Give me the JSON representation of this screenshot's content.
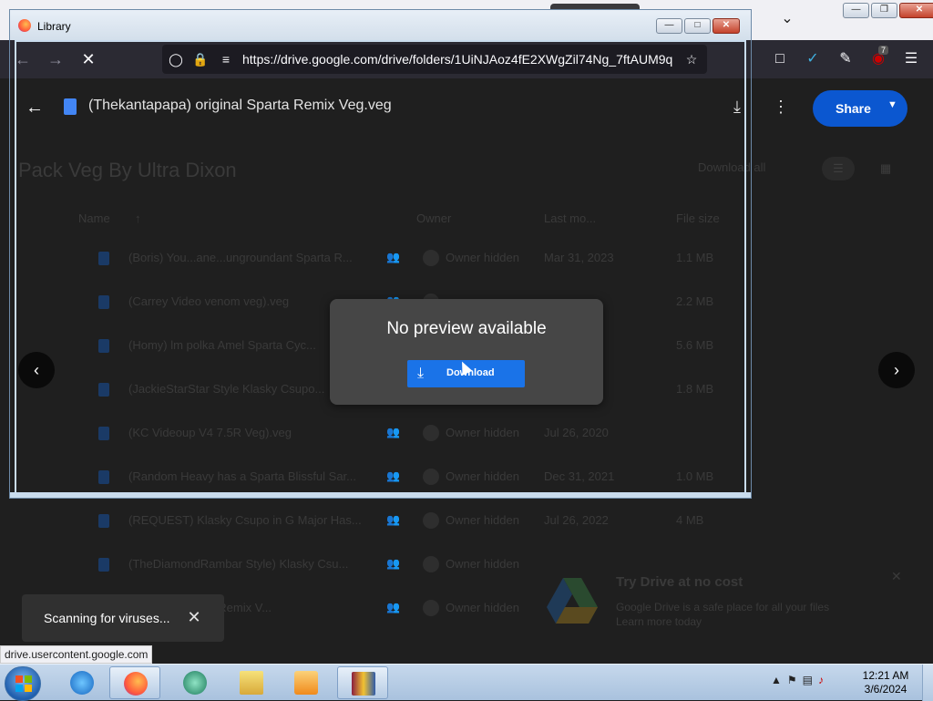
{
  "browser": {
    "url": "https://drive.google.com/drive/folders/1UiNJAoz4fE2XWgZil74Ng_7ftAUM9q",
    "status_text": "drive.usercontent.google.com",
    "extension_badge": "7"
  },
  "library_window": {
    "title": "Library"
  },
  "viewer": {
    "file_title": "(Thekantapapa) original Sparta Remix Veg.veg",
    "share_label": "Share",
    "no_preview_text": "No preview available",
    "download_label": "Download"
  },
  "folder": {
    "title": "Pack Veg By Ultra Dixon",
    "download_all": "Download all",
    "columns": [
      "Name",
      "Owner",
      "Last mo...",
      "File size"
    ],
    "rows": [
      {
        "name": "(Boris) You...ane...ungroundant Sparta R...",
        "owner": "Owner hidden",
        "date": "Mar 31, 2023",
        "size": "1.1 MB"
      },
      {
        "name": "(Carrey Video venom veg).veg",
        "owner": "",
        "date": "",
        "size": "2.2 MB"
      },
      {
        "name": "(Homy) lm polka Amel Sparta Cyc...",
        "owner": "",
        "date": "",
        "size": "5.6 MB"
      },
      {
        "name": "(JackieStarStar Style Klasky Csupo...",
        "owner": "",
        "date": "",
        "size": "1.8 MB"
      },
      {
        "name": "(KC Videoup V4 7.5R Veg).veg",
        "owner": "Owner hidden",
        "date": "Jul 26, 2020",
        "size": ""
      },
      {
        "name": "(Random Heavy has a Sparta Blissful Sar...",
        "owner": "Owner hidden",
        "date": "Dec 31, 2021",
        "size": "1.0 MB"
      },
      {
        "name": "(REQUEST) Klasky Csupo in G Major Has...",
        "owner": "Owner hidden",
        "date": "Jul 26, 2022",
        "size": "4 MB"
      },
      {
        "name": "(TheDiamondRambar Style) Klasky Csu...",
        "owner": "Owner hidden",
        "date": "",
        "size": ""
      },
      {
        "name": "...original Sparta Remix V...",
        "owner": "Owner hidden",
        "date": "",
        "size": ""
      }
    ]
  },
  "promo": {
    "title": "Try Drive at no cost",
    "text": "Google Drive is a safe place for all your files",
    "link": "Learn more today"
  },
  "toast": {
    "text": "Scanning for viruses..."
  },
  "taskbar": {
    "time": "12:21 AM",
    "date": "3/6/2024"
  }
}
